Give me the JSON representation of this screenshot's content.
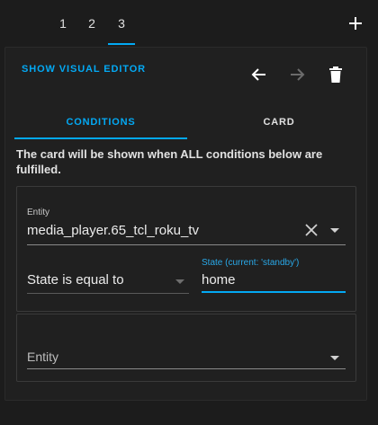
{
  "tabs": {
    "items": [
      {
        "label": "1"
      },
      {
        "label": "2"
      },
      {
        "label": "3"
      }
    ],
    "active_index": 2,
    "add_icon": "plus-icon"
  },
  "toolbar": {
    "show_visual_editor": "SHOW VISUAL EDITOR",
    "undo_icon": "arrow-left-icon",
    "redo_icon": "arrow-right-icon",
    "delete_icon": "trash-icon"
  },
  "subtabs": {
    "conditions": "CONDITIONS",
    "card": "CARD",
    "active": "conditions"
  },
  "info_text": "The card will be shown when ALL conditions below are fulfilled.",
  "condition1": {
    "entity_label": "Entity",
    "entity_value": "media_player.65_tcl_roku_tv",
    "state_mode": "State is equal to",
    "state_label": "State (current: 'standby')",
    "state_value": "home"
  },
  "condition2": {
    "entity_placeholder": "Entity"
  },
  "colors": {
    "accent": "#03a9f4",
    "background": "#1c1c1c",
    "text": "#e1e1e1"
  }
}
